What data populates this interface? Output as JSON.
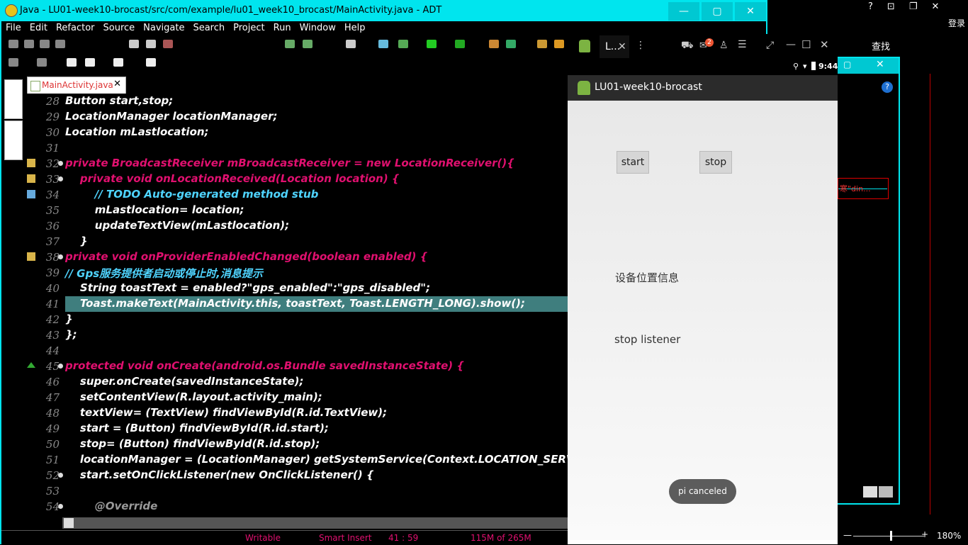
{
  "ide": {
    "title": "Java - LU01-week10-brocast/src/com/example/lu01_week10_brocast/MainActivity.java - ADT",
    "window_buttons": [
      "—",
      "▢",
      "✕"
    ],
    "menu": [
      "File",
      "Edit",
      "Refactor",
      "Source",
      "Navigate",
      "Search",
      "Project",
      "Run",
      "Window",
      "Help"
    ],
    "editor_tab": "MainActivity.java",
    "status": {
      "writable": "Writable",
      "insert_mode": "Smart Insert",
      "position": "41 : 59",
      "memory": "115M of 265M"
    }
  },
  "code_lines": [
    {
      "n": "28",
      "t": "Button start,stop;"
    },
    {
      "n": "29",
      "t": "LocationManager locationManager;"
    },
    {
      "n": "30",
      "t": "Location mLastlocation;"
    },
    {
      "n": "31",
      "t": ""
    },
    {
      "n": "32",
      "t": "private BroadcastReceiver mBroadcastReceiver = new LocationReceiver(){"
    },
    {
      "n": "33",
      "t": "    private void onLocationReceived(Location location) {"
    },
    {
      "n": "34",
      "t": "        // TODO Auto-generated method stub"
    },
    {
      "n": "35",
      "t": "        mLastlocation= location;"
    },
    {
      "n": "36",
      "t": "        updateTextView(mLastlocation);"
    },
    {
      "n": "37",
      "t": "    }"
    },
    {
      "n": "38",
      "t": "private void onProviderEnabledChanged(boolean enabled) {"
    },
    {
      "n": "39",
      "t": "// Gps服务提供者启动或停止时,消息提示"
    },
    {
      "n": "40",
      "t": "    String toastText = enabled?\"gps_enabled\":\"gps_disabled\";"
    },
    {
      "n": "41",
      "t": "    Toast.makeText(MainActivity.this, toastText, Toast.LENGTH_LONG).show();"
    },
    {
      "n": "42",
      "t": "}"
    },
    {
      "n": "43",
      "t": "};"
    },
    {
      "n": "44",
      "t": ""
    },
    {
      "n": "45",
      "t": "protected void onCreate(android.os.Bundle savedInstanceState) {"
    },
    {
      "n": "46",
      "t": "    super.onCreate(savedInstanceState);"
    },
    {
      "n": "47",
      "t": "    setContentView(R.layout.activity_main);"
    },
    {
      "n": "48",
      "t": "    textView= (TextView) findViewById(R.id.TextView);"
    },
    {
      "n": "49",
      "t": "    start = (Button) findViewById(R.id.start);"
    },
    {
      "n": "50",
      "t": "    stop= (Button) findViewById(R.id.stop);"
    },
    {
      "n": "51",
      "t": "    locationManager = (LocationManager) getSystemService(Context.LOCATION_SERVICE"
    },
    {
      "n": "52",
      "t": "    start.setOnClickListener(new OnClickListener() {"
    },
    {
      "n": "53",
      "t": ""
    },
    {
      "n": "54",
      "t": "        @Override"
    }
  ],
  "emulator": {
    "tab_label": "L...",
    "tab_close": "✕",
    "badge": "2",
    "clock": "9:44",
    "app_title": "LU01-week10-brocast",
    "start_button": "start",
    "stop_button": "stop",
    "location_label": "设备位置信息",
    "listener_label": "stop listener",
    "toast": "pi canceled"
  },
  "desktop": {
    "login": "登录",
    "search_label": "查找",
    "search_box_text": "寒\"din...",
    "zoom": "180%",
    "top_icons": [
      "?",
      "⊡",
      "❐",
      "✕"
    ]
  },
  "colors": {
    "accent": "#00e5ee",
    "keyword": "#e0106f",
    "field": "#e8d300",
    "comment": "#4fd4ff",
    "highlight": "#3f7e7e"
  }
}
